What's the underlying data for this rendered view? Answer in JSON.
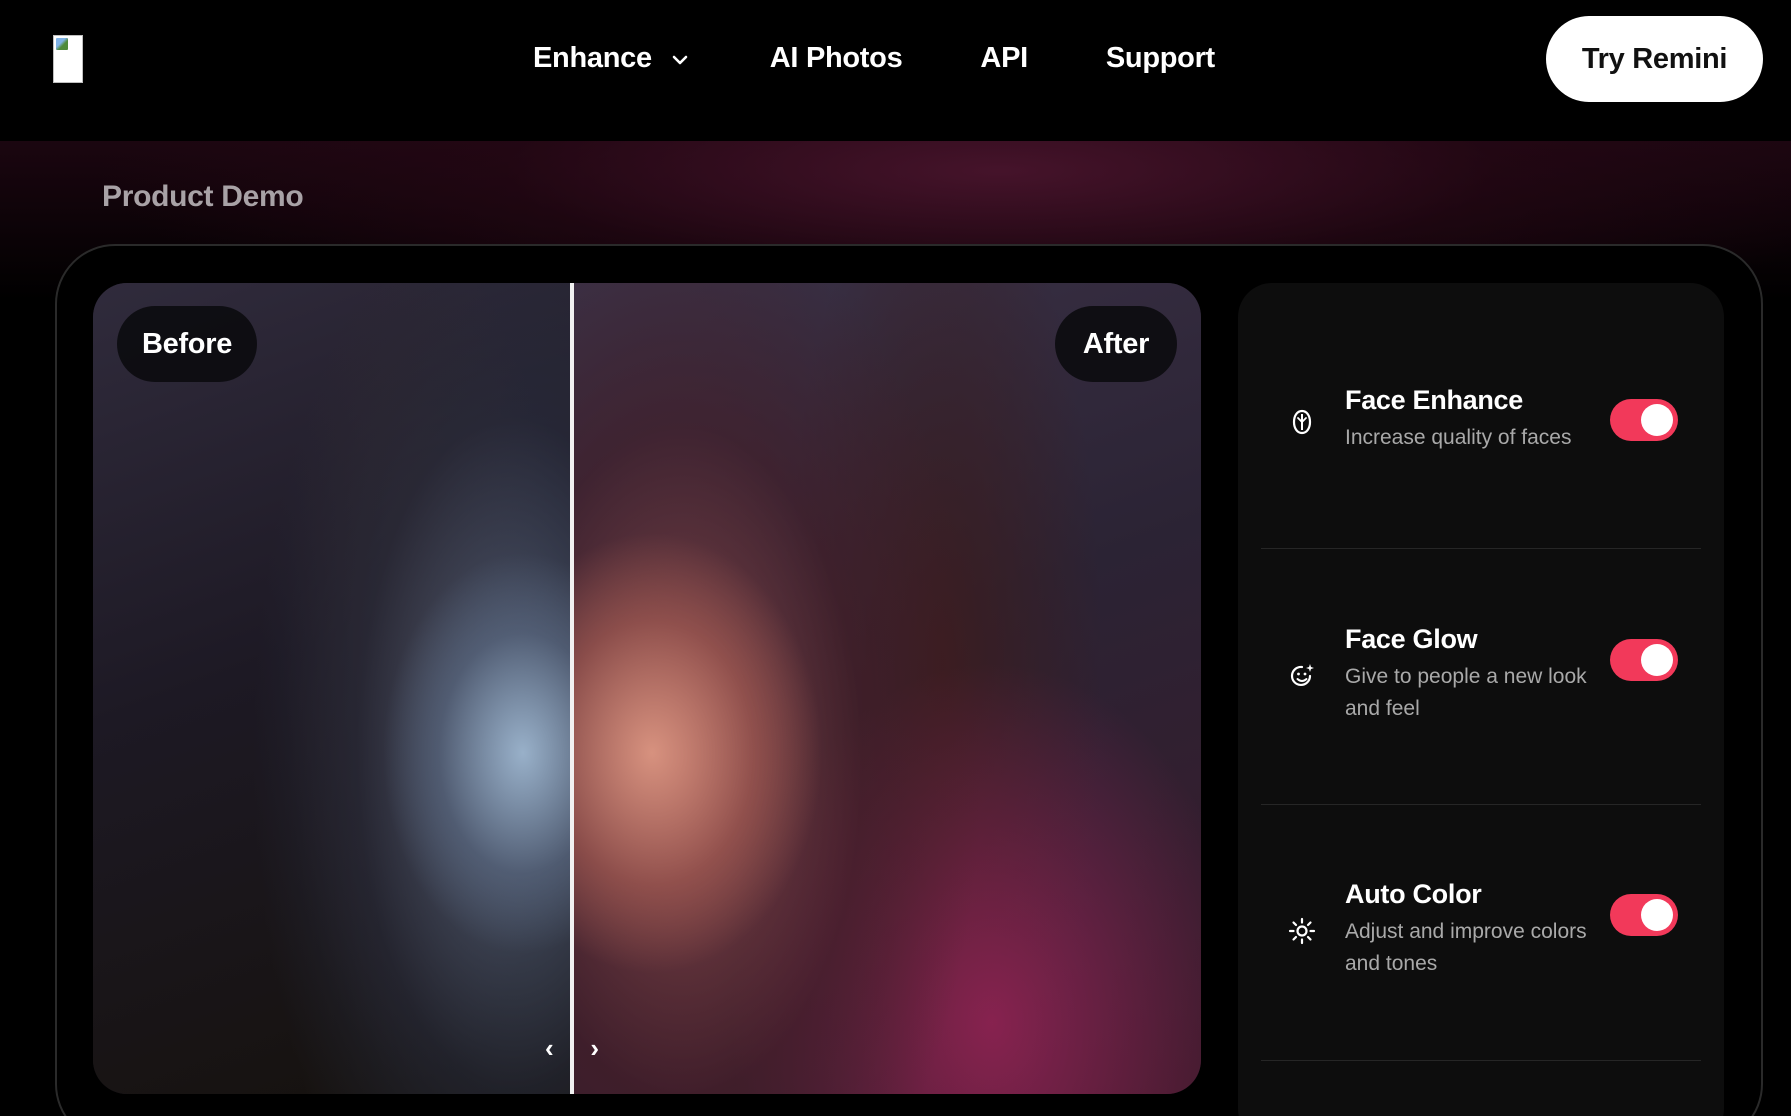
{
  "header": {
    "nav": [
      {
        "label": "Enhance",
        "has_dropdown": true
      },
      {
        "label": "AI Photos"
      },
      {
        "label": "API"
      },
      {
        "label": "Support"
      }
    ],
    "cta_label": "Try Remini"
  },
  "demo": {
    "section_title": "Product Demo",
    "before_label": "Before",
    "after_label": "After",
    "handle_left": "‹",
    "handle_right": "›",
    "slider_position": 0.43
  },
  "features": [
    {
      "icon": "face-enhance-icon",
      "title": "Face Enhance",
      "description": "Increase quality of faces",
      "enabled": true
    },
    {
      "icon": "face-glow-icon",
      "title": "Face Glow",
      "description": "Give to people a new look and feel",
      "enabled": true
    },
    {
      "icon": "sun-icon",
      "title": "Auto Color",
      "description": "Adjust and improve colors and tones",
      "enabled": true
    }
  ],
  "colors": {
    "accent": "#f2395a",
    "background": "#000000",
    "panel": "#0d0d0d",
    "cta_background": "#ffffff"
  }
}
